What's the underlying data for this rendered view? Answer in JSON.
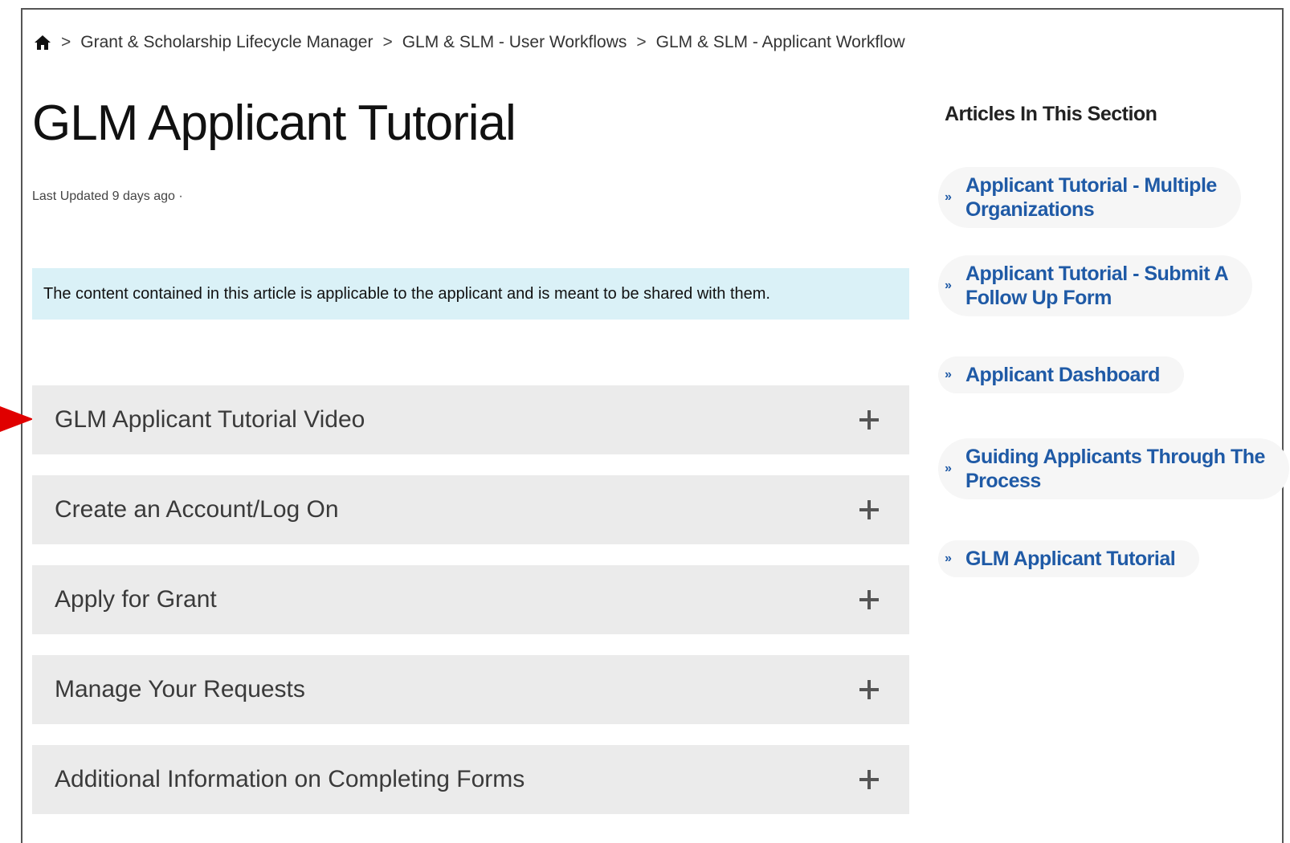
{
  "breadcrumb": {
    "home_icon": "home-icon",
    "items": [
      "Grant & Scholarship Lifecycle Manager",
      "GLM & SLM - User Workflows",
      "GLM & SLM - Applicant Workflow"
    ],
    "separator": ">"
  },
  "article": {
    "title": "GLM Applicant Tutorial",
    "last_updated": "Last Updated 9 days ago ·",
    "notice": "The content contained in this article is applicable to the applicant and is meant to be shared with them."
  },
  "accordion": [
    {
      "label": "GLM Applicant Tutorial Video",
      "icon": "plus-icon"
    },
    {
      "label": "Create an Account/Log On",
      "icon": "plus-icon"
    },
    {
      "label": "Apply for Grant",
      "icon": "plus-icon"
    },
    {
      "label": "Manage Your Requests",
      "icon": "plus-icon"
    },
    {
      "label": "Additional Information on Completing Forms",
      "icon": "plus-icon"
    }
  ],
  "sidebar": {
    "title": "Articles In This Section",
    "bullet": "»",
    "items": [
      {
        "line1": "Applicant Tutorial - Multiple",
        "line2": "Organizations"
      },
      {
        "line1": "Applicant Tutorial - Submit A",
        "line2": "Follow Up Form"
      },
      {
        "line1": "Applicant Dashboard",
        "line2": ""
      },
      {
        "line1": "Guiding Applicants Through The",
        "line2": "Process"
      },
      {
        "line1": "GLM Applicant Tutorial",
        "line2": ""
      }
    ]
  },
  "colors": {
    "link": "#1f5aa6",
    "notice_bg": "#daf1f7",
    "accordion_bg": "#ebebeb",
    "annotation_arrow": "#e00000"
  }
}
